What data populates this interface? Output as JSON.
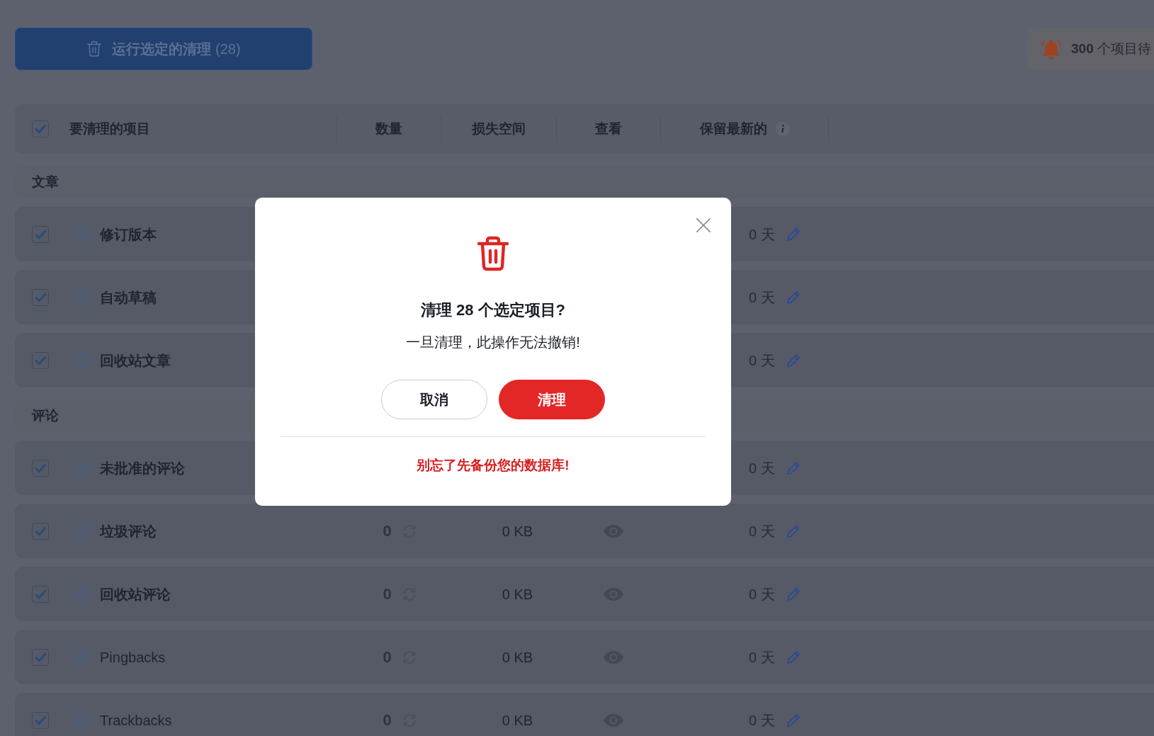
{
  "run_button": {
    "label": "**运行选定的清理** (28)"
  },
  "notice": {
    "text": "**300** 个项目待"
  },
  "table": {
    "select_all": {
      "checked": true
    },
    "columns": [
      {
        "label": "要清理的项目"
      },
      {
        "label": "数量"
      },
      {
        "label": "损失空间"
      },
      {
        "label": "查看"
      },
      {
        "label": "保留最新的",
        "info": true
      }
    ]
  },
  "sections": [
    {
      "title": "文章",
      "items": [
        {
          "name": "修订版本",
          "checked": true,
          "keep": "0 天"
        },
        {
          "name": "自动草稿",
          "checked": true,
          "keep": "0 天"
        },
        {
          "name": "回收站文章",
          "checked": true,
          "keep": "0 天"
        }
      ]
    },
    {
      "title": "评论",
      "items": [
        {
          "name": "未批准的评论",
          "checked": true,
          "keep": "0 天"
        },
        {
          "name": "垃圾评论",
          "checked": true,
          "count": "0",
          "size": "0 KB",
          "keep": "0 天"
        },
        {
          "name": "回收站评论",
          "checked": true,
          "count": "0",
          "size": "0 KB",
          "keep": "0 天"
        },
        {
          "name": "Pingbacks",
          "checked": true,
          "count": "0",
          "size": "0 KB",
          "keep": "0 天"
        },
        {
          "name": "Trackbacks",
          "checked": true,
          "count": "0",
          "size": "0 KB",
          "keep": "0 天"
        }
      ]
    }
  ],
  "dialog": {
    "title": "清理 28 个选定项目?",
    "message": "一旦清理，此操作无法撤销!",
    "cancel": "取消",
    "confirm": "清理",
    "warning": "别忘了先备份您的数据库!"
  }
}
